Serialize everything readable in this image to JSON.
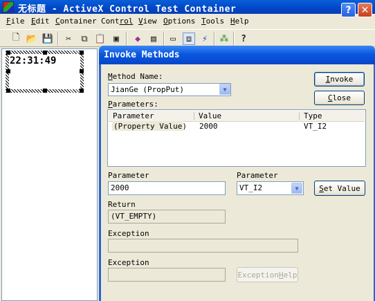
{
  "app": {
    "title": "无标题 - ActiveX Control Test Container"
  },
  "menu": [
    {
      "key": "F",
      "rest": "ile"
    },
    {
      "key": "E",
      "rest": "dit"
    },
    {
      "key": "C",
      "rest": "ontainer"
    },
    {
      "key": "Cont",
      "rest": "rol"
    },
    {
      "key": "V",
      "rest": "iew"
    },
    {
      "key": "O",
      "rest": "ptions"
    },
    {
      "key": "T",
      "rest": "ools"
    },
    {
      "key": "H",
      "rest": "elp"
    }
  ],
  "toolbar": {
    "icons": [
      "new-icon",
      "open-icon",
      "save-icon",
      "cut-icon",
      "copy-icon",
      "paste-icon",
      "insert-control-icon",
      "invoke-methods-icon",
      "properties-icon",
      "draw-metafile-icon",
      "events-icon",
      "event-log-icon",
      "hierarchy-icon",
      "help-icon"
    ]
  },
  "control": {
    "clock": "22:31:49"
  },
  "dialog": {
    "title": "Invoke Methods",
    "method_name_label": {
      "key": "M",
      "rest": "ethod Name:"
    },
    "method_name_value": "JianGe (PropPut)",
    "invoke_button": {
      "key": "I",
      "rest": "nvoke"
    },
    "close_button": {
      "key": "C",
      "rest": "lose"
    },
    "parameters_label": {
      "key": "P",
      "rest": "arameters:"
    },
    "columns": [
      "Parameter",
      "Value",
      "Type"
    ],
    "rows": [
      {
        "parameter": "(Property Value)",
        "value": "2000",
        "type": "VT_I2"
      }
    ],
    "parameter_value_label": "Parameter",
    "parameter_value": "2000",
    "parameter_type_label": "Parameter",
    "parameter_type": "VT_I2",
    "set_value_button": {
      "key": "S",
      "rest": "et Value"
    },
    "return_label": "Return",
    "return_value": "(VT_EMPTY)",
    "exception_label_1": "Exception",
    "exception_value_1": "",
    "exception_label_2": "Exception",
    "exception_value_2": "",
    "exception_help_button": {
      "rest1": "Exception ",
      "key": "H",
      "rest2": "elp"
    }
  },
  "colors": {
    "title_blue": "#0046c8",
    "dialog_face": "#ece9d8",
    "close_red": "#c8401f"
  }
}
